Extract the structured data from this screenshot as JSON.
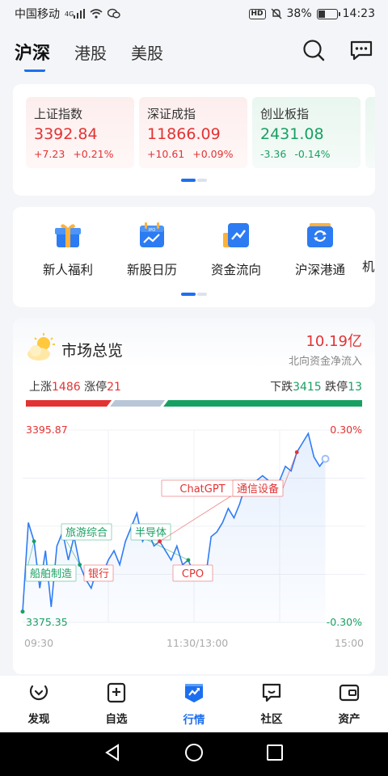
{
  "status_bar": {
    "carrier": "中国移动",
    "network": "4G",
    "battery": "38%",
    "time": "14:23",
    "battery_level": 0.38
  },
  "header": {
    "tabs": [
      "沪深",
      "港股",
      "美股"
    ],
    "active_tab": 0
  },
  "indices": [
    {
      "name": "上证指数",
      "value": "3392.84",
      "change": "+7.23",
      "pct": "+0.21%",
      "trend": "up"
    },
    {
      "name": "深证成指",
      "value": "11866.09",
      "change": "+10.61",
      "pct": "+0.09%",
      "trend": "up"
    },
    {
      "name": "创业板指",
      "value": "2431.08",
      "change": "-3.36",
      "pct": "-0.14%",
      "trend": "down"
    }
  ],
  "shortcuts": [
    {
      "label": "新人福利",
      "icon": "gift-icon"
    },
    {
      "label": "新股日历",
      "icon": "ipo-calendar-icon"
    },
    {
      "label": "资金流向",
      "icon": "fund-flow-icon"
    },
    {
      "label": "沪深港通",
      "icon": "connect-icon"
    },
    {
      "label": "机构",
      "icon": "institution-icon"
    }
  ],
  "market": {
    "title": "市场总览",
    "net_inflow_value": "10.19亿",
    "net_inflow_label": "北向资金净流入",
    "up_label": "上涨",
    "up_count": "1486",
    "limit_up_label": "涨停",
    "limit_up_count": "21",
    "down_label": "下跌",
    "down_count": "3415",
    "limit_down_label": "跌停",
    "limit_down_count": "13",
    "colors": {
      "up": "#e23333",
      "down": "#18a063",
      "flat": "#b9c6d8"
    }
  },
  "chart_data": {
    "type": "line",
    "ylim": [
      3375.35,
      3395.87
    ],
    "y_max_label": "3395.87",
    "y_min_label": "3375.35",
    "pct_max_label": "0.30%",
    "pct_min_label": "-0.30%",
    "x_ticks": [
      "09:30",
      "11:30/13:00",
      "15:00"
    ],
    "x_range_minutes": [
      0,
      240
    ],
    "series": [
      {
        "x": [
          0,
          4,
          8,
          12,
          16,
          20,
          24,
          28,
          32,
          36,
          40,
          44,
          48,
          52,
          56,
          60,
          64,
          68,
          72,
          76,
          80,
          84,
          88,
          92,
          96,
          100,
          104,
          108,
          112,
          116,
          120,
          124,
          128,
          132,
          136,
          140,
          144,
          148,
          152,
          156,
          160,
          164,
          168,
          172,
          176,
          180,
          184,
          188,
          192,
          196,
          200,
          204,
          208,
          212
        ],
        "values": [
          3376.5,
          3386.0,
          3384.0,
          3379.0,
          3383.0,
          3377.0,
          3383.5,
          3385.0,
          3382.0,
          3384.5,
          3381.5,
          3380.0,
          3379.0,
          3381.0,
          3380.5,
          3382.0,
          3383.0,
          3381.5,
          3384.0,
          3385.5,
          3387.0,
          3384.0,
          3385.0,
          3383.5,
          3384.0,
          3383.0,
          3382.0,
          3383.5,
          3381.5,
          3382.0,
          3380.5,
          3381.0,
          3380.0,
          3384.5,
          3385.0,
          3386.0,
          3387.5,
          3386.5,
          3388.0,
          3390.0,
          3389.0,
          3390.5,
          3391.0,
          3390.5,
          3389.5,
          3390.5,
          3392.0,
          3391.5,
          3393.5,
          3394.5,
          3395.5,
          3393.0,
          3392.0,
          3392.8
        ]
      }
    ],
    "annotations": [
      {
        "label": "船舶制造",
        "kind": "down"
      },
      {
        "label": "旅游综合",
        "kind": "down"
      },
      {
        "label": "银行",
        "kind": "up"
      },
      {
        "label": "半导体",
        "kind": "down"
      },
      {
        "label": "ChatGPT",
        "kind": "up"
      },
      {
        "label": "CPO",
        "kind": "up"
      },
      {
        "label": "通信设备",
        "kind": "up"
      }
    ]
  },
  "bottom_nav": [
    {
      "label": "发现",
      "icon": "discover-icon"
    },
    {
      "label": "自选",
      "icon": "watchlist-icon"
    },
    {
      "label": "行情",
      "icon": "market-icon"
    },
    {
      "label": "社区",
      "icon": "community-icon"
    },
    {
      "label": "资产",
      "icon": "assets-icon"
    }
  ],
  "active_nav": 2
}
